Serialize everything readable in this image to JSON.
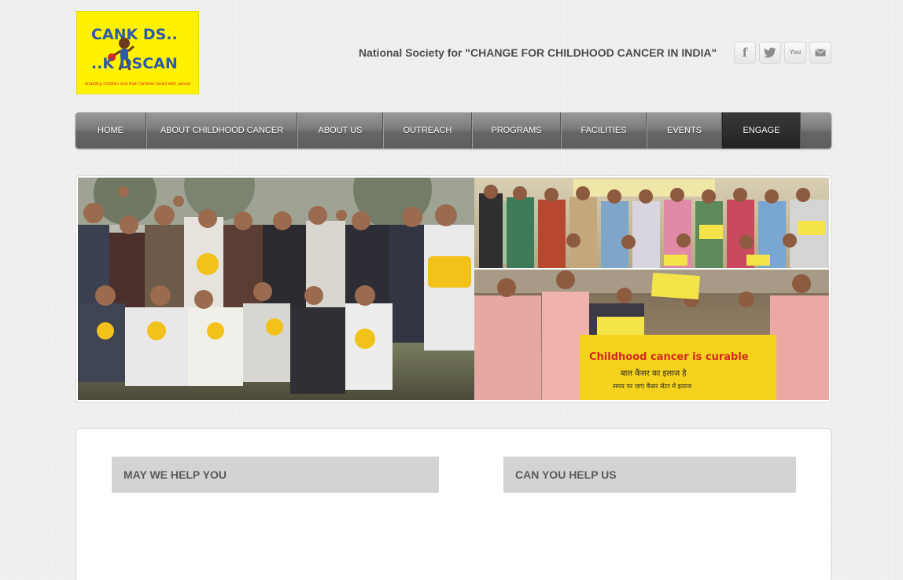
{
  "logo": {
    "line1": "CANK DS..",
    "line2": "..K DSCAN",
    "tagline": "enabling children and their families faced with cancer"
  },
  "header": {
    "tagline": "National Society for \"CHANGE FOR CHILDHOOD CANCER IN INDIA\""
  },
  "social": [
    {
      "icon": "facebook-icon",
      "glyph": "f"
    },
    {
      "icon": "twitter-icon",
      "glyph": "t"
    },
    {
      "icon": "youtube-icon",
      "glyph": "You"
    },
    {
      "icon": "mail-icon",
      "glyph": "✉"
    }
  ],
  "nav": {
    "items": [
      {
        "label": "HOME"
      },
      {
        "label": "ABOUT CHILDHOOD CANCER"
      },
      {
        "label": "ABOUT US"
      },
      {
        "label": "OUTREACH"
      },
      {
        "label": "PROGRAMS"
      },
      {
        "label": "FACILITIES"
      },
      {
        "label": "EVENTS"
      },
      {
        "label": "ENGAGE"
      }
    ],
    "active": "ENGAGE"
  },
  "banner": {
    "sign_en": "Childhood cancer is curable",
    "sign_hi": "बाल कैंसर का इलाज है",
    "sign_hi2": "समय पर जाएं कैंसर सेंटर में इलाज"
  },
  "content": {
    "left_heading": "MAY WE HELP YOU",
    "right_heading": "CAN YOU HELP US"
  },
  "colors": {
    "logo_bg": "#fff200",
    "nav_active": "#2a2a2a",
    "panel_bg": "#d3d3d3"
  }
}
